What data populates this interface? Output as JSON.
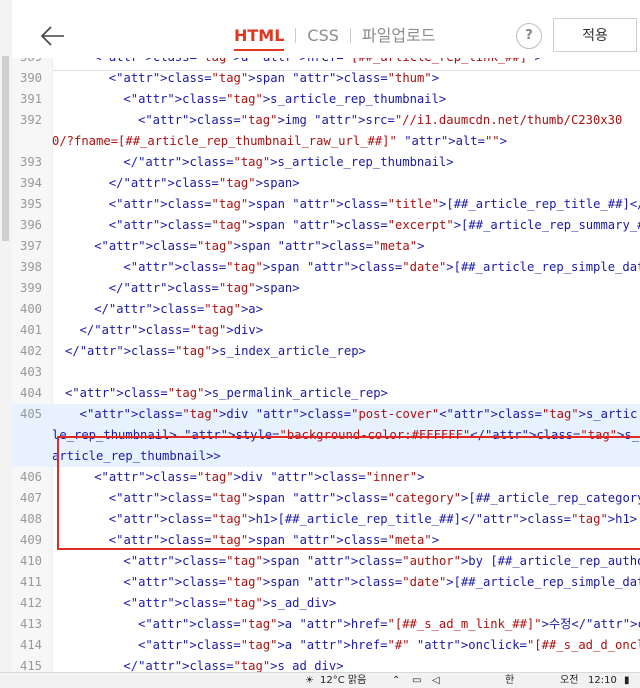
{
  "header": {
    "tabs": [
      {
        "label": "HTML",
        "active": true
      },
      {
        "label": "CSS",
        "active": false
      },
      {
        "label": "파일업로드",
        "active": false
      }
    ],
    "help_label": "?",
    "apply_label": "적용",
    "accent_color": "#e1361f"
  },
  "code_lines": [
    {
      "n": "389",
      "t": "<a href=\"[##_article_rep_link_##]\">",
      "indent": 8
    },
    {
      "n": "390",
      "t": "<span class=\"thum\">",
      "indent": 9
    },
    {
      "n": "391",
      "t": "<s_article_rep_thumbnail>",
      "indent": 10
    },
    {
      "n": "392",
      "t": "<img src=\"//i1.daumcdn.net/thumb/C230x300/?fname=[##_article_rep_thumbnail_raw_url_##]\" alt=\"\">",
      "indent": 11,
      "wrap": true
    },
    {
      "n": "393",
      "t": "</s_article_rep_thumbnail>",
      "indent": 10
    },
    {
      "n": "394",
      "t": "</span>",
      "indent": 9
    },
    {
      "n": "395",
      "t": "<span class=\"title\">[##_article_rep_title_##]</span>",
      "indent": 9
    },
    {
      "n": "396",
      "t": "<span class=\"excerpt\">[##_article_rep_summary_##]</span>",
      "indent": 9
    },
    {
      "n": "397",
      "t": "<span class=\"meta\">",
      "indent": 8
    },
    {
      "n": "398",
      "t": "<span class=\"date\">[##_article_rep_simple_date_##]</span>",
      "indent": 10
    },
    {
      "n": "399",
      "t": "</span>",
      "indent": 9
    },
    {
      "n": "400",
      "t": "</a>",
      "indent": 8
    },
    {
      "n": "401",
      "t": "</div>",
      "indent": 7
    },
    {
      "n": "402",
      "t": "</s_index_article_rep>",
      "indent": 6
    },
    {
      "n": "403",
      "t": "",
      "indent": 0
    },
    {
      "n": "404",
      "t": "<s_permalink_article_rep>",
      "indent": 6
    },
    {
      "n": "405",
      "t": "<div class=\"post-cover\"<s_article_rep_thumbnail> style=\"background-color:#FFFFFF\"</s_article_rep_thumbnail>>",
      "indent": 7,
      "wrap": true,
      "highlight": true
    },
    {
      "n": "406",
      "t": "<div class=\"inner\">",
      "indent": 8
    },
    {
      "n": "407",
      "t": "<span class=\"category\">[##_article_rep_category_##]</span>",
      "indent": 9
    },
    {
      "n": "408",
      "t": "<h1>[##_article_rep_title_##]</h1>",
      "indent": 9
    },
    {
      "n": "409",
      "t": "<span class=\"meta\">",
      "indent": 9
    },
    {
      "n": "410",
      "t": "<span class=\"author\">by [##_article_rep_author_##]</span>",
      "indent": 10
    },
    {
      "n": "411",
      "t": "<span class=\"date\">[##_article_rep_simple_date_##]</span>",
      "indent": 10
    },
    {
      "n": "412",
      "t": "<s_ad_div>",
      "indent": 10
    },
    {
      "n": "413",
      "t": "<a href=\"[##_s_ad_m_link_##]\">수정</a>",
      "indent": 11
    },
    {
      "n": "414",
      "t": "<a href=\"#\" onclick=\"[##_s_ad_d_onclick_##]\">삭제</a>",
      "indent": 11
    },
    {
      "n": "415",
      "t": "</s_ad_div>",
      "indent": 10
    }
  ],
  "taskbar": {
    "weather": "12°C 맑음",
    "ime": "한",
    "ampm": "오전",
    "time": "12:10"
  }
}
